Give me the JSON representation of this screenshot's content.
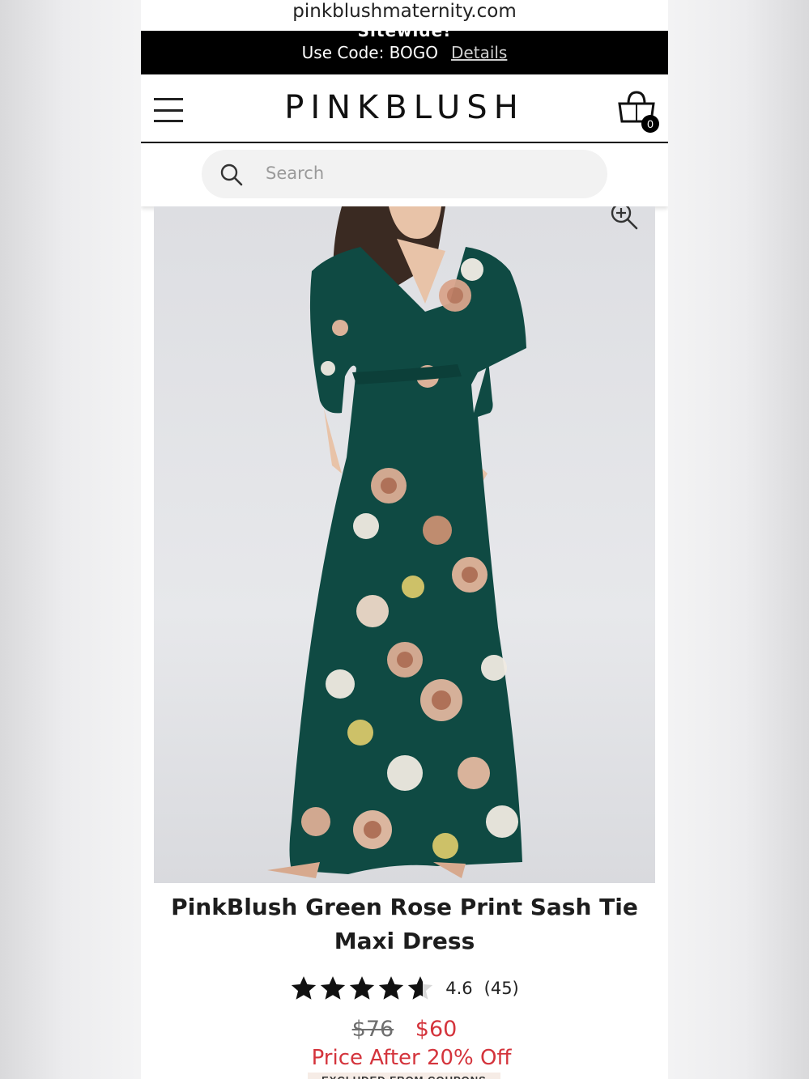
{
  "browser": {
    "url": "pinkblushmaternity.com"
  },
  "promo": {
    "headline": "Sitewide!",
    "code_text": "Use Code: BOGO",
    "details_link": "Details"
  },
  "header": {
    "logo": "PINKBLUSH",
    "cart_count": "0"
  },
  "search": {
    "placeholder": "Search"
  },
  "product": {
    "title": "PinkBlush Green Rose Print Sash Tie Maxi Dress",
    "rating_value": "4.6",
    "review_count": "(45)",
    "rating_stars": 4.6,
    "rating_max": 5,
    "original_price": "$76",
    "sale_price": "$60",
    "price_note": "Price After 20% Off",
    "excluded_note": "EXCLUDED FROM COUPONS",
    "image_alt": "Green Rose Print Sash Tie Maxi Dress"
  },
  "colors": {
    "accent_red": "#d4343c",
    "dress_green": "#0f4a43",
    "promo_bg": "#000000"
  }
}
